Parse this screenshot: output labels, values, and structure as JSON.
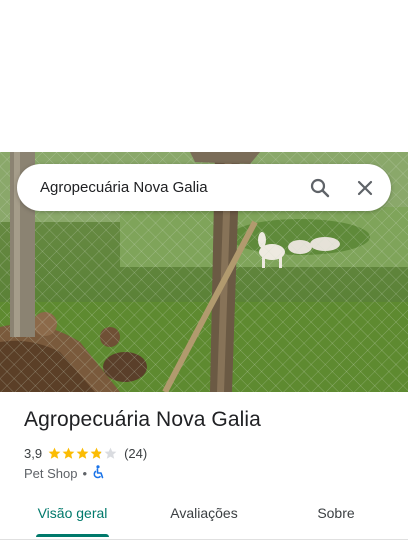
{
  "search": {
    "query": "Agropecuária Nova Galia",
    "search_icon": "search-icon",
    "close_icon": "close-icon"
  },
  "place": {
    "name": "Agropecuária Nova Galia",
    "rating": "3,9",
    "rating_value": 3.9,
    "rating_max": 5,
    "review_count": "(24)",
    "category": "Pet Shop",
    "separator": "•",
    "accessibility_icon": "wheelchair-icon"
  },
  "tabs": [
    {
      "label": "Visão geral",
      "active": true
    },
    {
      "label": "Avaliações",
      "active": false
    },
    {
      "label": "Sobre",
      "active": false
    }
  ],
  "colors": {
    "accent": "#00796b",
    "star": "#fbbc04",
    "star_empty": "#dadce0",
    "accessibility": "#1a73e8"
  }
}
